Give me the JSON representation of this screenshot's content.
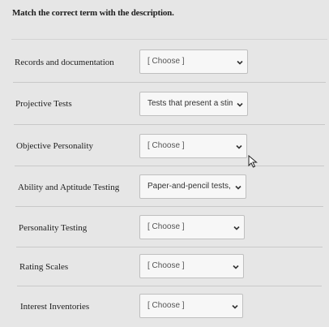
{
  "question": {
    "title": "Match the correct term with the description."
  },
  "rows": [
    {
      "term": "Records and documentation",
      "selected": "[ Choose ]"
    },
    {
      "term": "Projective Tests",
      "selected": "Tests that present a stimu"
    },
    {
      "term": "Objective Personality",
      "selected": "[ Choose ]"
    },
    {
      "term": "Ability and Aptitude Testing",
      "selected": "Paper-and-pencil tests, of"
    },
    {
      "term": "Personality Testing",
      "selected": "[ Choose ]"
    },
    {
      "term": "Rating Scales",
      "selected": "[ Choose ]"
    },
    {
      "term": "Interest Inventories",
      "selected": "[ Choose ]"
    }
  ],
  "icons": {
    "dropdown": "chevron-down-icon",
    "pointer": "mouse-pointer-icon"
  }
}
